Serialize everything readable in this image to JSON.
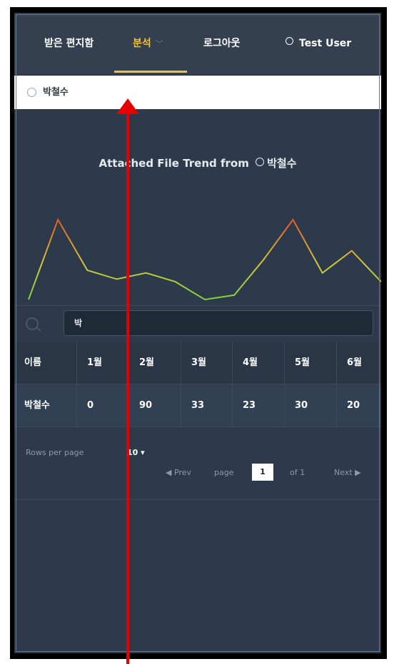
{
  "nav": {
    "inbox_label": "받은 편지함",
    "analysis_label": "분석",
    "logout_label": "로그아웃",
    "user_label": "Test User"
  },
  "search": {
    "value": "박철수"
  },
  "chart_title_prefix": "Attached File Trend from",
  "chart_title_name": "박철수",
  "chart_data": {
    "type": "line",
    "title": "Attached File Trend from 박철수",
    "x": [
      1,
      2,
      3,
      4,
      5,
      6,
      7,
      8,
      9,
      10,
      11,
      12,
      13
    ],
    "values": [
      0,
      90,
      33,
      23,
      30,
      20,
      0,
      5,
      45,
      90,
      30,
      55,
      20
    ],
    "note_colors": [
      "#7fd13b",
      "#f0a030",
      "#e04020"
    ]
  },
  "filter": {
    "value": "박"
  },
  "table": {
    "headers": [
      "이름",
      "1월",
      "2월",
      "3월",
      "4월",
      "5월",
      "6월"
    ],
    "rows": [
      [
        "박철수",
        "0",
        "90",
        "33",
        "23",
        "30",
        "20"
      ]
    ]
  },
  "pager": {
    "rows_per_page_label": "Rows per page",
    "rows_per_page_value": "10 ▾",
    "prev_label": "◀ Prev",
    "page_label": "page",
    "page_value": "1",
    "of_label": "of 1",
    "next_label": "Next ▶"
  }
}
